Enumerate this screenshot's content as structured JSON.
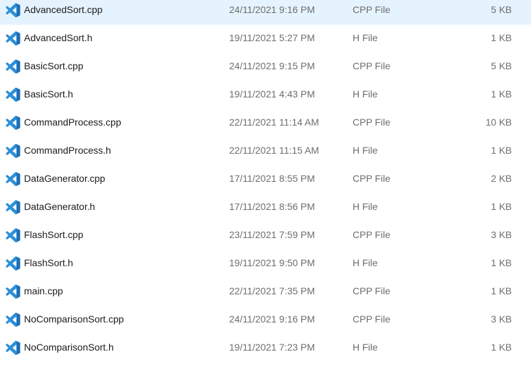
{
  "icon": "vscode-file-icon",
  "icon_color": "#2b8fd8",
  "files": [
    {
      "name": "AdvancedSort.cpp",
      "date": "24/11/2021 9:16 PM",
      "type": "CPP File",
      "size": "5 KB"
    },
    {
      "name": "AdvancedSort.h",
      "date": "19/11/2021 5:27 PM",
      "type": "H File",
      "size": "1 KB"
    },
    {
      "name": "BasicSort.cpp",
      "date": "24/11/2021 9:15 PM",
      "type": "CPP File",
      "size": "5 KB"
    },
    {
      "name": "BasicSort.h",
      "date": "19/11/2021 4:43 PM",
      "type": "H File",
      "size": "1 KB"
    },
    {
      "name": "CommandProcess.cpp",
      "date": "22/11/2021 11:14 AM",
      "type": "CPP File",
      "size": "10 KB"
    },
    {
      "name": "CommandProcess.h",
      "date": "22/11/2021 11:15 AM",
      "type": "H File",
      "size": "1 KB"
    },
    {
      "name": "DataGenerator.cpp",
      "date": "17/11/2021 8:55 PM",
      "type": "CPP File",
      "size": "2 KB"
    },
    {
      "name": "DataGenerator.h",
      "date": "17/11/2021 8:56 PM",
      "type": "H File",
      "size": "1 KB"
    },
    {
      "name": "FlashSort.cpp",
      "date": "23/11/2021 7:59 PM",
      "type": "CPP File",
      "size": "3 KB"
    },
    {
      "name": "FlashSort.h",
      "date": "19/11/2021 9:50 PM",
      "type": "H File",
      "size": "1 KB"
    },
    {
      "name": "main.cpp",
      "date": "22/11/2021 7:35 PM",
      "type": "CPP File",
      "size": "1 KB"
    },
    {
      "name": "NoComparisonSort.cpp",
      "date": "24/11/2021 9:16 PM",
      "type": "CPP File",
      "size": "3 KB"
    },
    {
      "name": "NoComparisonSort.h",
      "date": "19/11/2021 7:23 PM",
      "type": "H File",
      "size": "1 KB"
    }
  ]
}
